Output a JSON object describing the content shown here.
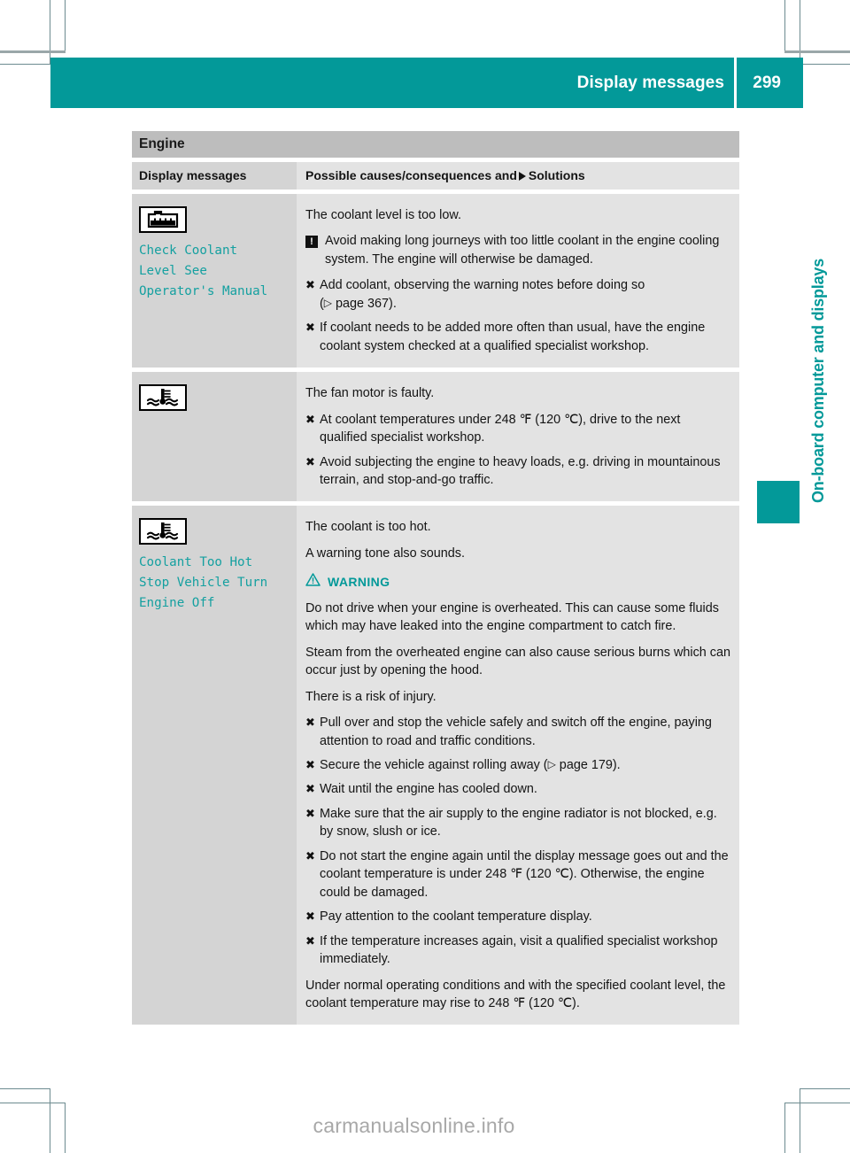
{
  "header": {
    "title": "Display messages",
    "page_number": "299"
  },
  "chapter_tab": {
    "label": "On-board computer and displays"
  },
  "table": {
    "section_title": "Engine",
    "columns": {
      "left": "Display messages",
      "right_prefix": "Possible causes/consequences and",
      "right_suffix": "Solutions"
    },
    "rows": [
      {
        "icon_name": "coolant-level-icon",
        "message": "Check Coolant\nLevel See\nOperator's Manual",
        "intro": "The coolant level is too low.",
        "note": {
          "badge": "!",
          "text": "Avoid making long journeys with too little coolant in the engine cooling system. The engine will otherwise be damaged."
        },
        "bullets": [
          "Add coolant, observing the warning notes before doing so ( page 367).",
          "If coolant needs to be added more often than usual, have the engine coolant system checked at a qualified specialist workshop."
        ]
      },
      {
        "icon_name": "coolant-temperature-icon",
        "message": "",
        "intro": "The fan motor is faulty.",
        "bullets": [
          "At coolant temperatures under 248 ℉ (120 ℃), drive to the next qualified specialist workshop.",
          "Avoid subjecting the engine to heavy loads, e.g. driving in mountainous terrain, and stop-and-go traffic."
        ]
      },
      {
        "icon_name": "coolant-temperature-icon",
        "message": "Coolant Too Hot\nStop Vehicle Turn\nEngine Off",
        "intro": "The coolant is too hot.",
        "intro2": "A warning tone also sounds.",
        "warning_label": "WARNING",
        "warning_paragraphs": [
          "Do not drive when your engine is overheated. This can cause some fluids which may have leaked into the engine compartment to catch fire.",
          "Steam from the overheated engine can also cause serious burns which can occur just by opening the hood.",
          "There is a risk of injury."
        ],
        "bullets": [
          "Pull over and stop the vehicle safely and switch off the engine, paying attention to road and traffic conditions.",
          "Secure the vehicle against rolling away ( page 179).",
          "Wait until the engine has cooled down.",
          "Make sure that the air supply to the engine radiator is not blocked, e.g. by snow, slush or ice.",
          "Do not start the engine again until the display message goes out and the coolant temperature is under 248 ℉ (120 ℃). Otherwise, the engine could be damaged.",
          "Pay attention to the coolant temperature display.",
          "If the temperature increases again, visit a qualified specialist workshop immediately."
        ],
        "closing": "Under normal operating conditions and with the specified coolant level, the coolant temperature may rise to 248 ℉ (120 ℃)."
      }
    ]
  },
  "watermark": {
    "text": "carmanualsonline.info"
  },
  "colors": {
    "teal": "#039999",
    "section_band": "#bdbdbd",
    "cell_left": "#d4d4d4",
    "cell_right": "#e3e3e3",
    "message_text": "#14a0a0"
  }
}
